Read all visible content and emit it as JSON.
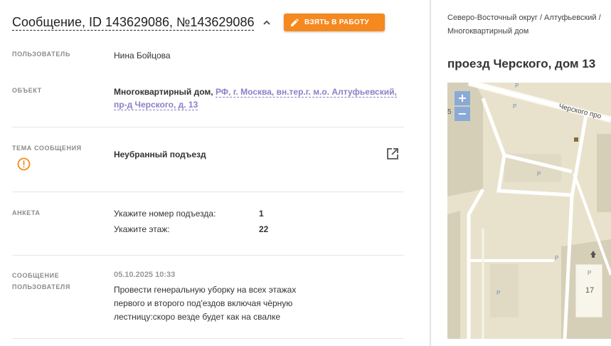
{
  "header": {
    "title": "Сообщение, ID 143629086, №143629086",
    "take_button_label": "ВЗЯТЬ В РАБОТУ"
  },
  "fields": {
    "user": {
      "label": "ПОЛЬЗОВАТЕЛЬ",
      "value": "Нина Бойцова"
    },
    "object": {
      "label": "ОБЪЕКТ",
      "type_text": "Многоквартирный дом,",
      "address_link": "РФ, г. Москва, вн.тер.г. м.о. Алтуфьевский, пр-д Черского, д. 13"
    },
    "topic": {
      "label": "ТЕМА СООБЩЕНИЯ",
      "value": "Неубранный подъезд"
    },
    "survey": {
      "label": "АНКЕТА",
      "rows": [
        {
          "q": "Укажите номер подъезда:",
          "a": "1"
        },
        {
          "q": "Укажите этаж:",
          "a": "22"
        }
      ]
    },
    "message": {
      "label_line1": "СООБЩЕНИЕ",
      "label_line2": "ПОЛЬЗОВАТЕЛЯ",
      "date": "05.10.2025 10:33",
      "text": "Провести генеральную уборку на всех этажах первого и второго под'ездов включая чёрную лестницу:скоро везде будет как на свалке"
    }
  },
  "side": {
    "breadcrumb": "Северо-Восточный округ / Алтуфьевский / Многоквартирный дом",
    "address": "проезд Черского, дом 13",
    "map": {
      "street_label": "Черского про",
      "building_number": "17",
      "edge_number": "5",
      "parking_label": "P",
      "zoom_in": "+",
      "zoom_out": "−"
    }
  },
  "colors": {
    "accent": "#f5891f",
    "link": "#8b7fc8",
    "map_bg": "#e8e2cc",
    "zoom": "#8aaad6"
  }
}
